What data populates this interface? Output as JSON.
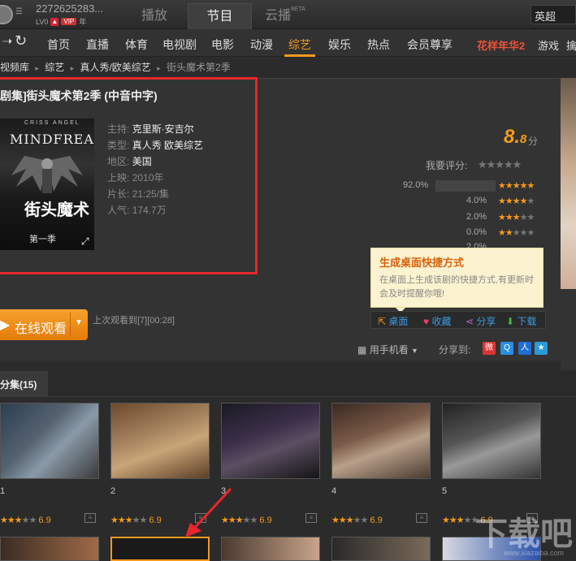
{
  "account": {
    "name": "2272625283...",
    "level": "LV0",
    "vip": "VIP",
    "year": "年"
  },
  "top_tabs": [
    {
      "label": "播放"
    },
    {
      "label": "节目"
    },
    {
      "label": "云播",
      "sup": "BETA"
    }
  ],
  "search": {
    "value": "英超"
  },
  "nav": {
    "items": [
      "首页",
      "直播",
      "体育",
      "电视剧",
      "电影",
      "动漫",
      "综艺",
      "娱乐",
      "热点",
      "会员尊享"
    ],
    "active": "综艺",
    "promo": "花样年华2",
    "extra": [
      "游戏",
      "擒"
    ]
  },
  "breadcrumb": [
    "视频库",
    "综艺",
    "真人秀/欧美综艺",
    "街头魔术第2季"
  ],
  "show": {
    "title": "剧集]街头魔术第2季 (中音中字)",
    "poster_top": "CRISS ANGEL",
    "poster_brand": "MINDFREAK",
    "poster_cn": "街头魔术",
    "poster_season": "第一季",
    "info": [
      {
        "k": "主持:",
        "v": "克里斯·安吉尔"
      },
      {
        "k": "类型:",
        "v": "真人秀 欧美综艺"
      },
      {
        "k": "地区:",
        "v": "美国"
      },
      {
        "k": "上映:",
        "v": "2010年"
      },
      {
        "k": "片长:",
        "v": "21:25/集"
      },
      {
        "k": "人气:",
        "v": "174.7万"
      }
    ]
  },
  "rating": {
    "score_int": "8.",
    "score_dec": "8",
    "unit": "分",
    "my_rating_label": "我要评分:",
    "distribution": [
      {
        "pct": "92.0%",
        "stars": 5
      },
      {
        "pct": "4.0%",
        "stars": 4
      },
      {
        "pct": "2.0%",
        "stars": 3
      },
      {
        "pct": "0.0%",
        "stars": 2
      },
      {
        "pct": "2.0%",
        "stars": 1
      }
    ]
  },
  "tooltip": {
    "title": "生成桌面快捷方式",
    "body": "在桌面上生成该剧的快捷方式,有更新时会及时提醒你哦!"
  },
  "actions": {
    "desktop": "桌面",
    "favorite": "收藏",
    "share": "分享",
    "download": "下载"
  },
  "watch": {
    "label": "在线观看",
    "last": "上次观看到[7][00:28]"
  },
  "mobile": {
    "label": "用手机看"
  },
  "share_to": {
    "label": "分享到:"
  },
  "episodes": {
    "tab": "分集",
    "count": "(15)",
    "items": [
      {
        "num": "1",
        "score": "6.9"
      },
      {
        "num": "2",
        "score": "6.9"
      },
      {
        "num": "3",
        "score": "6.9"
      },
      {
        "num": "4",
        "score": "6.9"
      },
      {
        "num": "5",
        "score": "6.9"
      }
    ]
  },
  "watermark": {
    "text": "下载吧",
    "sub": "www.xiazaiba.com"
  },
  "colors": {
    "accent": "#f39a1e",
    "highlight_box": "#e8262b",
    "promo": "#e9533a"
  }
}
